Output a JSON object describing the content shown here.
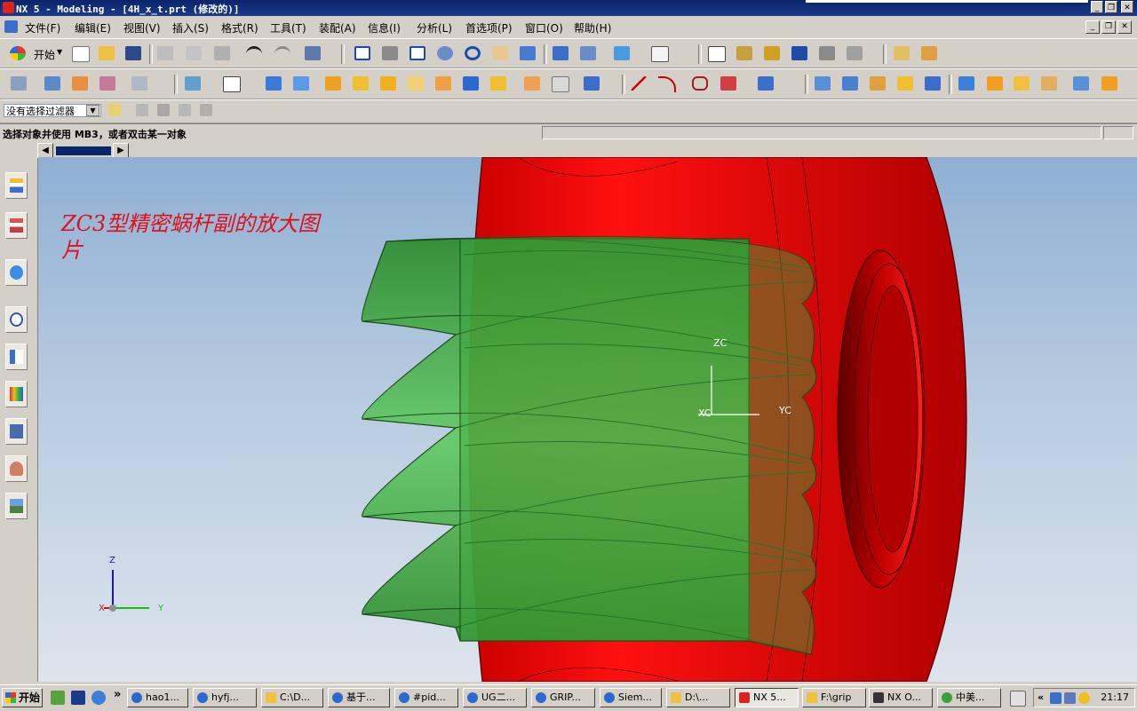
{
  "window": {
    "title": "NX 5 - Modeling - [4H_x_t.prt (修改的)]",
    "controls": [
      "minimize",
      "restore",
      "close"
    ]
  },
  "menubar": {
    "items": [
      "文件(F)",
      "编辑(E)",
      "视图(V)",
      "插入(S)",
      "格式(R)",
      "工具(T)",
      "装配(A)",
      "信息(I)",
      "分析(L)",
      "首选项(P)",
      "窗口(O)",
      "帮助(H)"
    ]
  },
  "toolbar": {
    "start_label": "开始",
    "filter_value": "没有选择过滤器"
  },
  "status": {
    "prompt": "选择对象并使用 MB3，或者双击某一对象"
  },
  "graphics": {
    "annotation": "ZC3型精密蜗杆副的放大图片",
    "wcs": {
      "z": "ZC",
      "x": "XC",
      "y": "YC"
    },
    "abs_triad": {
      "z": "Z",
      "x": "X",
      "y": "Y"
    },
    "colors": {
      "worm_wheel": "#ff0000",
      "worm": "#3cb43c",
      "annotation": "#e0101a"
    }
  },
  "taskbar": {
    "start": "开始",
    "more": "»",
    "tasks": [
      "hao1...",
      "hyfj...",
      "C:\\D...",
      "基于...",
      "#pid...",
      "UG二...",
      "GRIP...",
      "Siem...",
      "D:\\...",
      "NX 5...",
      "F:\\grip",
      "NX O...",
      "中美..."
    ],
    "clock": "21:17"
  }
}
